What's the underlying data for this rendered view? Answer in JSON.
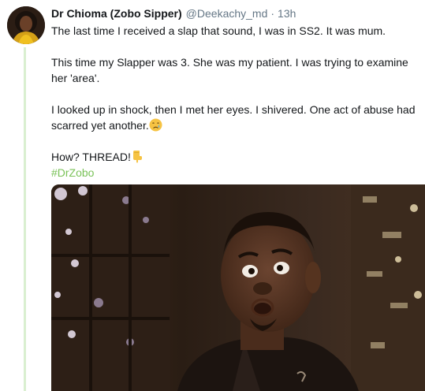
{
  "tweet": {
    "author_name": "Dr Chioma (Zobo Sipper)",
    "handle": "@Deekachy_md",
    "separator": "·",
    "time": "13h",
    "paragraph_1": "The last time I received a slap that sound, I was in SS2. It was mum.",
    "paragraph_2": "This time my Slapper was 3. She was my patient. I was trying to examine her 'area'.",
    "paragraph_3": "I looked up in shock, then I met her eyes. I shivered. One act of abuse had scarred yet another.",
    "paragraph_4": "How? THREAD!",
    "hashtag": "#DrZobo",
    "emoji_1": "crying-face-emoji",
    "emoji_2": "pointing-down-emoji"
  },
  "colors": {
    "hashtag": "#79c257",
    "thread_line": "#d9efd0",
    "secondary_text": "#657786"
  }
}
